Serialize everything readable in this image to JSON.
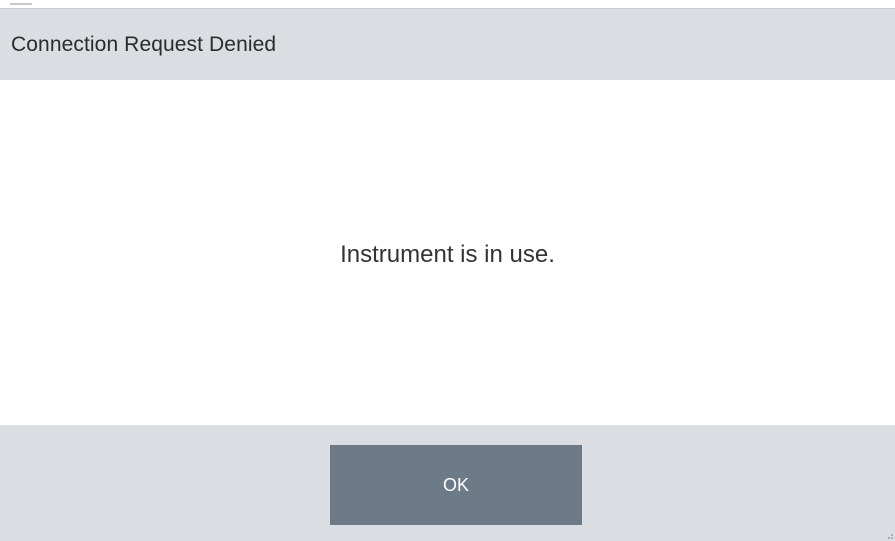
{
  "dialog": {
    "title": "Connection Request Denied",
    "message": "Instrument is in use.",
    "ok_label": "OK"
  },
  "colors": {
    "title_bar_bg": "#dadde2",
    "footer_bg": "#dadde2",
    "button_bg": "#6d7b88",
    "button_text": "#ffffff",
    "text": "#333333"
  },
  "icons": {
    "resize_grip": "resize-grip-icon"
  }
}
